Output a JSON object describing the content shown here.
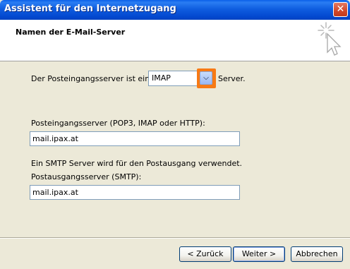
{
  "window": {
    "title": "Assistent für den Internetzugang",
    "close_icon": "close-icon"
  },
  "header": {
    "heading": "Namen der E-Mail-Server",
    "icon": "wizard-sparkle-cursor-icon"
  },
  "form": {
    "server_type_prefix": "Der Posteingangsserver ist ein",
    "server_type_value": "IMAP",
    "server_type_suffix": "Server.",
    "incoming_label": "Posteingangsserver (POP3, IMAP oder HTTP):",
    "incoming_value": "mail.ipax.at",
    "smtp_note": "Ein SMTP Server wird für den Postausgang verwendet.",
    "outgoing_label": "Postausgangsserver (SMTP):",
    "outgoing_value": "mail.ipax.at"
  },
  "buttons": {
    "back": "< Zurück",
    "next": "Weiter >",
    "cancel": "Abbrechen"
  },
  "colors": {
    "titlebar": "#0348cf",
    "highlight": "#f77a15",
    "background": "#ece9d8"
  }
}
